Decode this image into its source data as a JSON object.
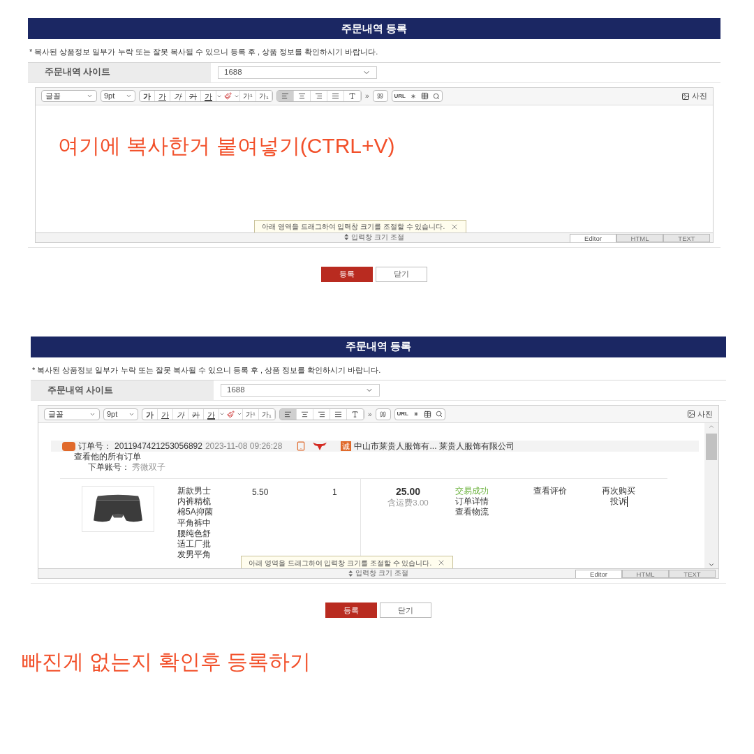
{
  "panels": [
    {
      "title": "주문내역 등록",
      "notice": "* 복사된 상품정보 일부가 누락 또는 잘못 복사될 수 있으니 등록 후 , 상품 정보를 확인하시기 바랍니다.",
      "site_label": "주문내역 사이트",
      "site_value": "1688",
      "toolbar": {
        "font": "글꼴",
        "size": "9pt",
        "format_buttons": [
          {
            "label": "가",
            "kind": "bold"
          },
          {
            "label": "가",
            "kind": "underline"
          },
          {
            "label": "가",
            "kind": "italic"
          },
          {
            "label": "가",
            "kind": "strike"
          },
          {
            "label": "가",
            "kind": "color"
          }
        ],
        "script_buttons": [
          "가¹",
          "가₁"
        ],
        "align_buttons": [
          {
            "kind": "left",
            "selected": true
          },
          {
            "kind": "center",
            "selected": false
          },
          {
            "kind": "right",
            "selected": false
          },
          {
            "kind": "justify",
            "selected": false
          },
          {
            "kind": "clear",
            "selected": false
          }
        ],
        "more": "»",
        "url": "URL",
        "photo": "사진"
      },
      "content": {
        "kind": "annotation",
        "text": "여기에 복사한거 붙여넣기(CTRL+V)"
      },
      "tooltip": "아래 영역을 드래그하여 입력창 크기를 조절할 수 있습니다.",
      "resize_label": "입력창 크기 조절",
      "mode_tabs": [
        {
          "label": "Editor",
          "selected": true
        },
        {
          "label": "HTML",
          "selected": false
        },
        {
          "label": "TEXT",
          "selected": false
        }
      ],
      "buttons": [
        {
          "label": "등록",
          "kind": "primary"
        },
        {
          "label": "닫기",
          "kind": "secondary"
        }
      ]
    },
    {
      "title": "주문내역 등록",
      "notice": "* 복사된 상품정보 일부가 누락 또는 잘못 복사될 수 있으니 등록 후 , 상품 정보를 확인하시기 바랍니다.",
      "site_label": "주문내역 사이트",
      "site_value": "1688",
      "toolbar": {
        "font": "글꼴",
        "size": "9pt",
        "format_buttons": [
          {
            "label": "가",
            "kind": "bold"
          },
          {
            "label": "가",
            "kind": "underline"
          },
          {
            "label": "가",
            "kind": "italic"
          },
          {
            "label": "가",
            "kind": "strike"
          },
          {
            "label": "가",
            "kind": "color"
          }
        ],
        "script_buttons": [
          "가¹",
          "가₁"
        ],
        "align_buttons": [
          {
            "kind": "left",
            "selected": true
          },
          {
            "kind": "center",
            "selected": false
          },
          {
            "kind": "right",
            "selected": false
          },
          {
            "kind": "justify",
            "selected": false
          },
          {
            "kind": "clear",
            "selected": false
          }
        ],
        "more": "»",
        "url": "URL",
        "photo": "사진"
      },
      "content": {
        "kind": "order",
        "order_label": "订单号：",
        "order_number": "2011947421253056892",
        "date": "2023-11-08 09:26:28",
        "trust_badge": "诚",
        "shop_short": "中山市莱贵人服饰有...",
        "shop_full": "莱贵人服饰有限公司",
        "all_orders": "查看他的所有订单",
        "account_label": "下单账号：",
        "account": "秀微双子",
        "item": {
          "title": "新款男士内裤精梳棉5A抑菌平角裤中腰纯色舒适工厂批发男平角",
          "price": "5.50",
          "quantity": "1",
          "total": "25.00",
          "shipping": "含运费3.00",
          "status": "交易成功",
          "detail": "订单详情",
          "logistics": "查看物流",
          "review": "查看评价",
          "rebuy": "再次购买",
          "complaint": "投诉"
        }
      },
      "tooltip": "아래 영역을 드래그하여 입력창 크기를 조절할 수 있습니다.",
      "resize_label": "입력창 크기 조절",
      "mode_tabs": [
        {
          "label": "Editor",
          "selected": true
        },
        {
          "label": "HTML",
          "selected": false
        },
        {
          "label": "TEXT",
          "selected": false
        }
      ],
      "buttons": [
        {
          "label": "등록",
          "kind": "primary"
        },
        {
          "label": "닫기",
          "kind": "secondary"
        }
      ]
    }
  ],
  "caption": "빠진게 없는지 확인후 등록하기"
}
